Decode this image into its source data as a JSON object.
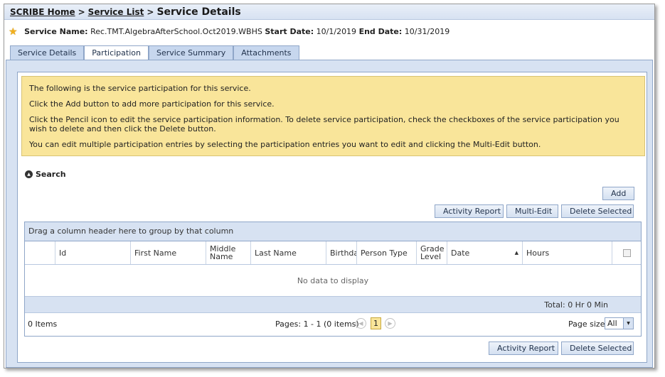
{
  "breadcrumb": {
    "home": "SCRIBE Home",
    "sep1": ">",
    "list": "Service List",
    "sep2": ">",
    "title": "Service Details"
  },
  "service": {
    "name_label": "Service Name:",
    "name": "Rec.TMT.AlgebraAfterSchool.Oct2019.WBHS",
    "start_label": "Start Date:",
    "start": "10/1/2019",
    "end_label": "End Date:",
    "end": "10/31/2019"
  },
  "tabs": [
    {
      "label": "Service Details"
    },
    {
      "label": "Participation"
    },
    {
      "label": "Service Summary"
    },
    {
      "label": "Attachments"
    }
  ],
  "notice": {
    "line1": "The following is the service participation for this service.",
    "line2": "Click the Add button to add more participation for this service.",
    "line3": "Click the Pencil icon to edit the service participation information. To delete service participation, check the checkboxes of the service participation you wish to delete and then click the Delete button.",
    "line4": "You can edit multiple participation entries by selecting the participation entries you want to edit and clicking the Multi-Edit button."
  },
  "search": {
    "label": "Search"
  },
  "buttons": {
    "add": "Add",
    "activity_report": "Activity Report",
    "multi_edit": "Multi-Edit",
    "delete_selected": "Delete Selected"
  },
  "grid": {
    "group_hint": "Drag a column header here to group by that column",
    "columns": [
      "Id",
      "First Name",
      "Middle Name",
      "Last Name",
      "Birthdate",
      "Person Type",
      "Grade Level",
      "Date",
      "Hours"
    ],
    "empty_text": "No data to display",
    "total": "Total: 0 Hr 0 Min"
  },
  "pager": {
    "items": "0 Items",
    "summary": "Pages: 1 - 1 (0 items)",
    "current_page": "1",
    "page_size_label": "Page size:",
    "page_size": "All"
  },
  "colors": {
    "accent": "#d7e2f2",
    "notice_bg": "#f9e59a",
    "border": "#8fa6c8"
  }
}
